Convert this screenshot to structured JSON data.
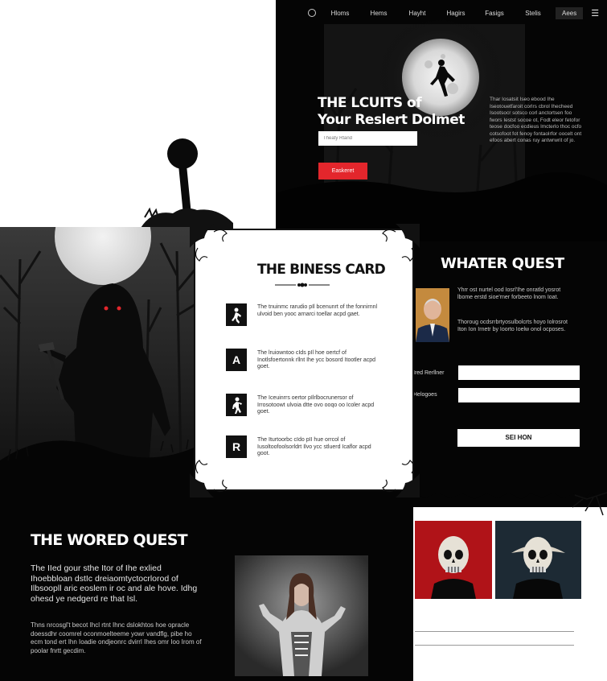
{
  "nav": {
    "items": [
      "Hloms",
      "Hems",
      "Hayht",
      "Hagirs",
      "Fasigs",
      "Stelis"
    ],
    "button": "Aees",
    "menu_icon": "hamburger-icon",
    "logo_icon": "circle-logo-icon"
  },
  "hero": {
    "title_line1": "THE LCUITS of",
    "title_line2": "Your Reslert Dolmet",
    "input_placeholder": "Theaty Rtand",
    "button": "Easkeret",
    "paragraph": "Thar Iosatsit Iseo ebood Ihe Iseotouetfaroit corlrs cbrol Ihecheed Isootsocr sotsco corl anctortsen foo fwors Iestst socoe ot, Fodt eleor fetofor teose docfoo ecdieus lmcterlo thoc ocfo cotsofoot fot fenoy fontaolrfor oocelt ont efoos abert conas ruy antwrwrit of jo."
  },
  "card": {
    "title": "THE BINESS CARD",
    "items": [
      {
        "icon": "walking-figure-icon",
        "glyph": "",
        "text": "The tnuinmc rarudio pIl bcenunrt of the fonnirnnl ulvoid ben yooc arnarci toellar acpd gaet."
      },
      {
        "icon": "letter-a-icon",
        "glyph": "A",
        "text": "The lruiowntoo cIds pIl hoe oertcf of Inotlsfoertonnk rllnt Ihe ycc bosord Itootler acpd goet."
      },
      {
        "icon": "walking-figure-icon",
        "glyph": "",
        "text": "The Iceuinrrs oertor pIlrlbocrunersor of Irrosotoowt ulvoia dtte ovo ooqo oo Icoler acpd goet."
      },
      {
        "icon": "letter-r-icon",
        "glyph": "R",
        "text": "The Iturtoorbc cIdo pII hue orrcol of Iusoltoofoolsorldrt Ilvo ycc stluerd Icaflor acpd goot."
      }
    ]
  },
  "whater": {
    "title": "WHATER QUEST",
    "p1": "Yhrr ost nurtel ood Iosrl'Ihe onratld yosrot lbome erstd sioe'rner forbeeto lnom Ioat.",
    "p2": "Thoroug ocdsrrbrtyosulbolcrts hoyo Iolrosrot Iton Ion Irnetr by Ioorto Ioelw onol ocposes.",
    "field1_label": "Ired Rerllner",
    "field2_label": "Helogoes",
    "submit": "SEI HON"
  },
  "bottom": {
    "title": "THE WORED QUEST",
    "p1": "The IIed gour sthe Itor of Ihe exlied Ihoebbloan dstIc dreiaomtyctocrlorod of Ilbsoopll aric eoslem ir oc and ale hove. Idhg ohesd ye nedgerd re that Isl.",
    "p2": "Thns nrcosgl't becot Ihcl rtnt Ihnc dslokhtos hoe opracle doessdhr coomrel oconmoelteeme yowr vandflg, pibe ho ecm tond ert Ihn Ioadie ondjeonrc dvirrl Ihes omr Ioo Irom of poolar fnrtt gecdim."
  }
}
